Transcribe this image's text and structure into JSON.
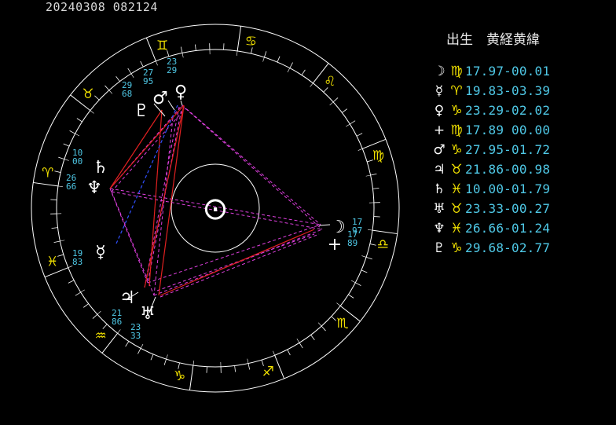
{
  "header": {
    "timestamp": "20240308  082124"
  },
  "panel": {
    "title": "出生　黄経黄緯",
    "rows": [
      {
        "planet": "☽",
        "sign": "♍",
        "values": "17.97-00.01"
      },
      {
        "planet": "☿",
        "sign": "♈",
        "values": "19.83-03.39"
      },
      {
        "planet": "♀",
        "sign": "♑",
        "values": "23.29-02.02"
      },
      {
        "planet": "+",
        "sign": "♍",
        "values": "17.89 00.00"
      },
      {
        "planet": "♂",
        "sign": "♑",
        "values": "27.95-01.72"
      },
      {
        "planet": "♃",
        "sign": "♉",
        "values": "21.86-00.98"
      },
      {
        "planet": "♄",
        "sign": "♓",
        "values": "10.00-01.79"
      },
      {
        "planet": "♅",
        "sign": "♉",
        "values": "23.33-00.27"
      },
      {
        "planet": "♆",
        "sign": "♓",
        "values": "26.66-01.24"
      },
      {
        "planet": "♇",
        "sign": "♑",
        "values": "29.68-02.77"
      }
    ]
  },
  "wheel": {
    "center_symbol": "⊙",
    "signs": [
      "♈",
      "♉",
      "♊",
      "♋",
      "♌",
      "♍",
      "♎",
      "♏",
      "♐",
      "♑",
      "♒",
      "♓"
    ],
    "planets": [
      {
        "id": "moon",
        "glyph": "☽",
        "deg": "17",
        "min": "97"
      },
      {
        "id": "node",
        "glyph": "+",
        "deg": "17",
        "min": "89"
      },
      {
        "id": "mercury",
        "glyph": "☿",
        "deg": "19",
        "min": "83"
      },
      {
        "id": "saturn",
        "glyph": "♄",
        "deg": "10",
        "min": "00"
      },
      {
        "id": "neptune",
        "glyph": "♆",
        "deg": "26",
        "min": "66"
      },
      {
        "id": "pluto",
        "glyph": "♇",
        "deg": "29",
        "min": "68"
      },
      {
        "id": "mars",
        "glyph": "♂",
        "deg": "27",
        "min": "95"
      },
      {
        "id": "venus",
        "glyph": "♀",
        "deg": "23",
        "min": "29"
      },
      {
        "id": "jupiter",
        "glyph": "♃",
        "deg": "21",
        "min": "86"
      },
      {
        "id": "uranus",
        "glyph": "♅",
        "deg": "23",
        "min": "33"
      }
    ]
  },
  "colors": {
    "ring": "#ffffff",
    "sign_glyph": "#f0e000",
    "values": "#4fc8e6",
    "aspect_red": "#e02020",
    "aspect_magenta": "#e040e0",
    "aspect_blue": "#3050ff"
  }
}
